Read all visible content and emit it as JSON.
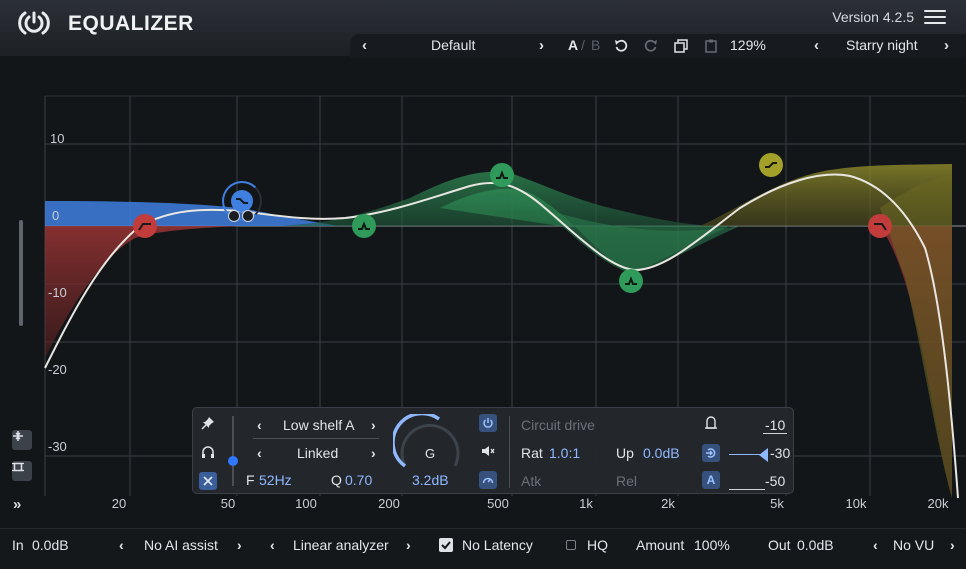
{
  "header": {
    "title": "EQUALIZER",
    "version": "Version 4.2.5"
  },
  "preset_bar": {
    "prev": "‹",
    "preset": "Default",
    "next": "›",
    "ab_a": "A",
    "ab_sep": "/",
    "ab_b": "B",
    "zoom": "129%",
    "style_prev": "‹",
    "style": "Starry night",
    "style_next": "›"
  },
  "graph": {
    "db_labels": [
      "10",
      "0",
      "-10",
      "-20",
      "-30"
    ],
    "freq_labels": [
      "20",
      "50",
      "100",
      "200",
      "500",
      "1k",
      "2k",
      "5k",
      "10k",
      "20k"
    ],
    "expand": "»",
    "colors": {
      "blue_band": "#3f7fe0",
      "red_band": "#c03a3a",
      "green_band": "#2f9a5a",
      "olive_band": "#a3a02a",
      "curve": "#e8e6e0"
    }
  },
  "panel": {
    "shape_prev": "‹",
    "shape": "Low shelf A",
    "shape_next": "›",
    "stereo_prev": "‹",
    "stereo": "Linked",
    "stereo_next": "›",
    "freq_label": "F",
    "freq_value": "52Hz",
    "q_label": "Q",
    "q_value": "0.70",
    "gain_label": "G",
    "gain_value": "3.2dB",
    "drive_title": "Circuit drive",
    "rat_label": "Rat",
    "rat_value": "1.0:1",
    "up_label": "Up",
    "up_value": "0.0dB",
    "atk_label": "Atk",
    "rel_label": "Rel",
    "auto_label": "A",
    "range_values": [
      "-10",
      "-30",
      "-50"
    ]
  },
  "footer": {
    "in_label": "In",
    "in_value": "0.0dB",
    "ai_prev": "‹",
    "ai_mode": "No AI assist",
    "ai_next": "›",
    "analyzer_prev": "‹",
    "analyzer": "Linear analyzer",
    "analyzer_next": "›",
    "latency_label": "No Latency",
    "latency_checked": true,
    "hq_label": "HQ",
    "hq_checked": false,
    "amount_label": "Amount",
    "amount_value": "100%",
    "out_label": "Out",
    "out_value": "0.0dB",
    "vu_prev": "‹",
    "vu_mode": "No VU",
    "vu_next": "›"
  }
}
